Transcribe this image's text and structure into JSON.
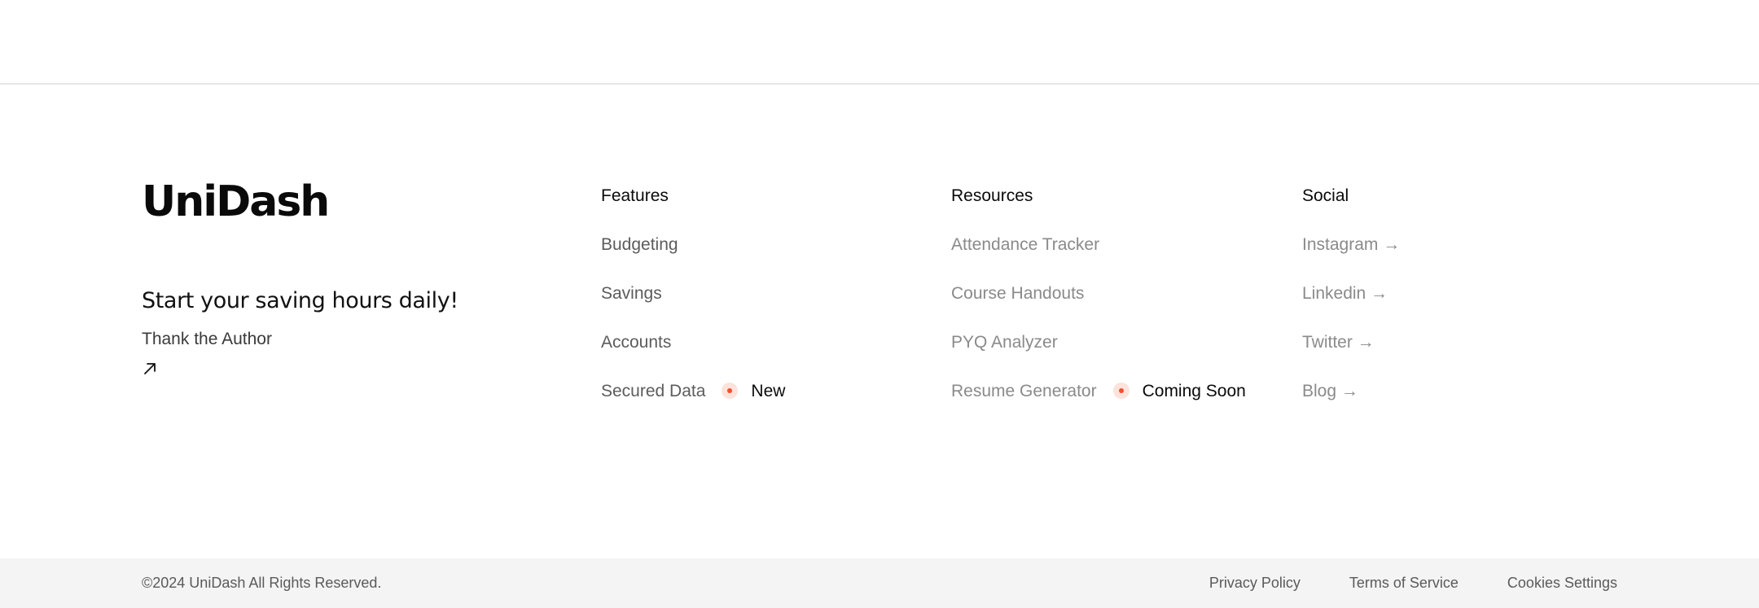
{
  "brand": {
    "logo": "UniDash",
    "tagline": "Start your saving hours daily!",
    "author_link": "Thank the Author",
    "author_icon": "arrow-up-right-icon"
  },
  "columns": {
    "features": {
      "heading": "Features",
      "items": [
        {
          "label": "Budgeting"
        },
        {
          "label": "Savings"
        },
        {
          "label": "Accounts"
        },
        {
          "label": "Secured Data",
          "badge": "New"
        }
      ]
    },
    "resources": {
      "heading": "Resources",
      "items": [
        {
          "label": "Attendance Tracker"
        },
        {
          "label": "Course Handouts"
        },
        {
          "label": "PYQ Analyzer"
        },
        {
          "label": "Resume Generator",
          "badge": "Coming Soon"
        }
      ]
    },
    "social": {
      "heading": "Social",
      "items": [
        {
          "label": "Instagram →"
        },
        {
          "label": "Linkedin →"
        },
        {
          "label": "Twitter →"
        },
        {
          "label": "Blog →"
        }
      ]
    }
  },
  "bottom_bar": {
    "copyright": "©2024 UniDash All Rights Reserved.",
    "links": [
      "Privacy Policy",
      "Terms of Service",
      "Cookies Settings"
    ]
  },
  "colors": {
    "badge_dot": "#f0502a",
    "badge_halo": "#fde3dc",
    "bottom_bar_bg": "#f4f4f4"
  }
}
